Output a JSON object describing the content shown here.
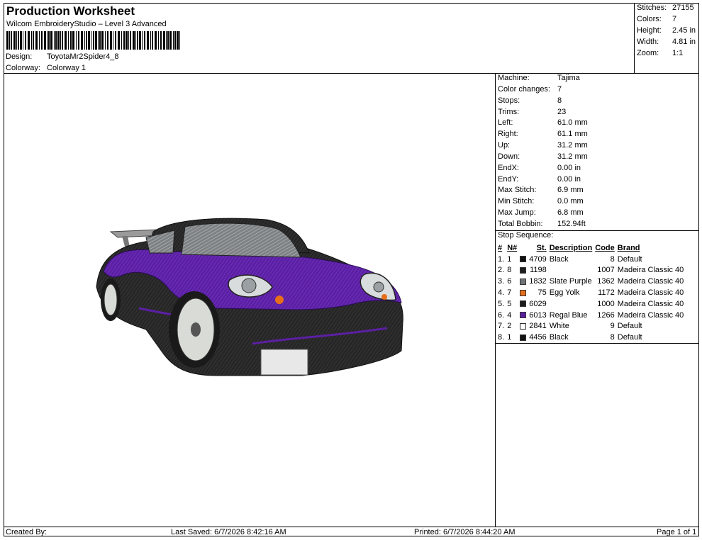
{
  "header": {
    "title": "Production Worksheet",
    "subtitle": "Wilcom EmbroideryStudio – Level 3 Advanced",
    "design_label": "Design:",
    "design_value": "ToyotaMr2Spider4_8",
    "colorway_label": "Colorway:",
    "colorway_value": "Colorway 1"
  },
  "stats": [
    {
      "label": "Stitches:",
      "value": "27155"
    },
    {
      "label": "Colors:",
      "value": "7"
    },
    {
      "label": "Height:",
      "value": "2.45 in"
    },
    {
      "label": "Width:",
      "value": "4.81 in"
    },
    {
      "label": "Zoom:",
      "value": "1:1"
    }
  ],
  "machine": [
    {
      "label": "Machine:",
      "value": "Tajima"
    },
    {
      "label": "Color changes:",
      "value": "7"
    },
    {
      "label": "Stops:",
      "value": "8"
    },
    {
      "label": "Trims:",
      "value": "23"
    },
    {
      "label": "Left:",
      "value": "61.0 mm"
    },
    {
      "label": "Right:",
      "value": "61.1 mm"
    },
    {
      "label": "Up:",
      "value": "31.2 mm"
    },
    {
      "label": "Down:",
      "value": "31.2 mm"
    },
    {
      "label": "EndX:",
      "value": "0.00 in"
    },
    {
      "label": "EndY:",
      "value": "0.00 in"
    },
    {
      "label": "Max Stitch:",
      "value": "6.9 mm"
    },
    {
      "label": "Min Stitch:",
      "value": "0.0 mm"
    },
    {
      "label": "Max Jump:",
      "value": "6.8 mm"
    },
    {
      "label": "Total Bobbin:",
      "value": "152.94ft"
    }
  ],
  "stop_sequence": {
    "title": "Stop Sequence:",
    "headers": [
      "#",
      "N#",
      "St.",
      "Description",
      "Code",
      "Brand"
    ],
    "rows": [
      {
        "num": "1.",
        "n": "1",
        "color": "#111111",
        "st": "4709",
        "desc": "Black",
        "code": "8",
        "brand": "Default"
      },
      {
        "num": "2.",
        "n": "8",
        "color": "#1e1e1e",
        "st": "1198",
        "desc": "",
        "code": "1007",
        "brand": "Madeira Classic 40"
      },
      {
        "num": "3.",
        "n": "6",
        "color": "#6f7478",
        "st": "1832",
        "desc": "Slate Purple",
        "code": "1362",
        "brand": "Madeira Classic 40"
      },
      {
        "num": "4.",
        "n": "7",
        "color": "#e86e1a",
        "st": "75",
        "desc": "Egg Yolk",
        "code": "1172",
        "brand": "Madeira Classic 40"
      },
      {
        "num": "5.",
        "n": "5",
        "color": "#1c1c1c",
        "st": "6029",
        "desc": "",
        "code": "1000",
        "brand": "Madeira Classic 40"
      },
      {
        "num": "6.",
        "n": "4",
        "color": "#5a1f9e",
        "st": "6013",
        "desc": "Regal Blue",
        "code": "1266",
        "brand": "Madeira Classic 40"
      },
      {
        "num": "7.",
        "n": "2",
        "color": "#ffffff",
        "st": "2841",
        "desc": "White",
        "code": "9",
        "brand": "Default"
      },
      {
        "num": "8.",
        "n": "1",
        "color": "#111111",
        "st": "4456",
        "desc": "Black",
        "code": "8",
        "brand": "Default"
      }
    ]
  },
  "footer": {
    "created_by": "Created By:",
    "last_saved": "Last Saved: 6/7/2026 8:42:16 AM",
    "printed": "Printed: 6/7/2026 8:44:20 AM",
    "page": "Page 1 of 1"
  },
  "colors": {
    "body_purple": "#5b1fa3",
    "body_dark": "#2b2b2b",
    "window_gray": "#8d9194"
  }
}
